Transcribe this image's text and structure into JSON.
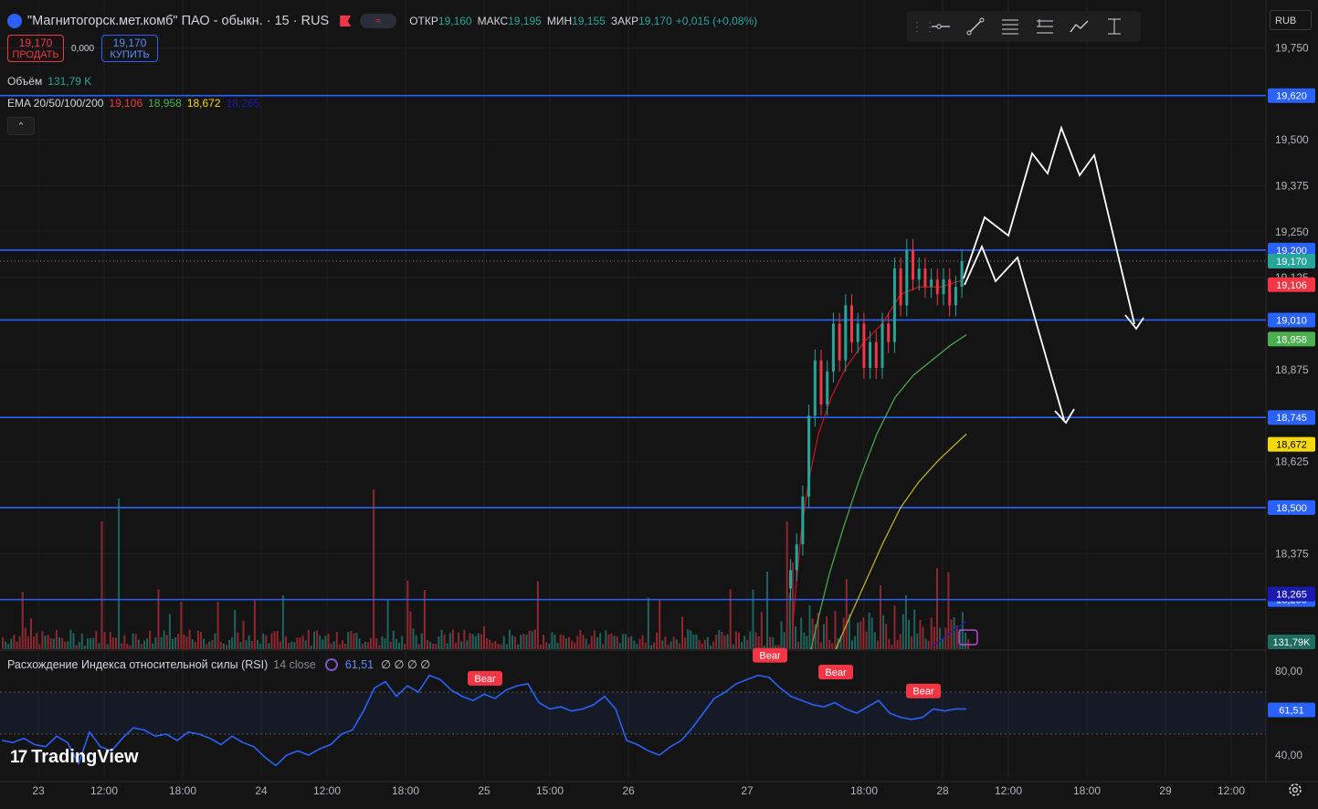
{
  "header": {
    "title": "\"Магнитогорск.мет.комб\" ПАО - обыкн. · 15 · RUS",
    "open_label": "ОТКР",
    "open_value": "19,160",
    "high_label": "МАКС",
    "high_value": "19,195",
    "low_label": "МИН",
    "low_value": "19,155",
    "close_label": "ЗАКР",
    "close_value": "19,170",
    "change": "+0,015 (+0,08%)"
  },
  "trade": {
    "sell_price": "19,170",
    "sell_label": "ПРОДАТЬ",
    "spread": "0,000",
    "buy_price": "19,170",
    "buy_label": "КУПИТЬ"
  },
  "volume_legend": {
    "label": "Объём",
    "value": "131,79 K"
  },
  "ema_legend": {
    "label": "EMA 20/50/100/200",
    "v20": "19,106",
    "v50": "18,958",
    "v100": "18,672",
    "v200": "18,265"
  },
  "currency": "RUB",
  "rsi_legend": {
    "label": "Расхождение Индекса относительной силы (RSI)",
    "params": "14 close",
    "value": "61,51",
    "extra": "∅ ∅ ∅ ∅"
  },
  "brand": "TradingView",
  "colors": {
    "bg": "#141414",
    "up": "#26a69a",
    "down": "#f23645",
    "level": "#2962ff",
    "ema20": "#c8161d",
    "ema50": "#4caf50",
    "ema100": "#c7b831",
    "ema200": "#1a1ab0",
    "rsi": "#2962ff",
    "bear": "#f23645",
    "arrow": "#ffffff"
  },
  "toolbar_icons": [
    "horizontal-ray-icon",
    "trend-line-icon",
    "fib-icon",
    "long-position-icon",
    "path-icon",
    "measure-icon"
  ],
  "chart_data": {
    "type": "candlestick",
    "price_axis": {
      "ylim": [
        18.115,
        19.88
      ],
      "ticks": [
        "19,750",
        "19,500",
        "19,375",
        "19,250",
        "19,125",
        "18,875",
        "18,625",
        "18,375"
      ],
      "tick_values": [
        19.75,
        19.5,
        19.375,
        19.25,
        19.125,
        18.875,
        18.625,
        18.375
      ]
    },
    "time_axis": {
      "labels": [
        "23",
        "12:00",
        "18:00",
        "24",
        "12:00",
        "18:00",
        "25",
        "15:00",
        "26",
        "27",
        "18:00",
        "28",
        "12:00",
        "18:00",
        "29",
        "12:00"
      ]
    },
    "levels": [
      19.62,
      19.2,
      19.01,
      18.745,
      18.5,
      18.25
    ],
    "level_labels": [
      "19,620",
      "19,200",
      "19,010",
      "18,745",
      "18,500",
      "18,250"
    ],
    "last_price": "19,170",
    "ema_values": {
      "ema20": "19,106",
      "ema50": "18,958",
      "ema100": "18,672",
      "ema200": "18,265"
    },
    "volume_last": "131,79K",
    "candles_last_day": [
      [
        18.28,
        18.33
      ],
      [
        18.33,
        18.4
      ],
      [
        18.4,
        18.53
      ],
      [
        18.53,
        18.75
      ],
      [
        18.75,
        18.9
      ],
      [
        18.9,
        18.78
      ],
      [
        18.78,
        18.87
      ],
      [
        18.87,
        19.0
      ],
      [
        19.0,
        18.9
      ],
      [
        18.9,
        19.05
      ],
      [
        19.05,
        18.95
      ],
      [
        18.95,
        19.0
      ],
      [
        19.0,
        18.88
      ],
      [
        18.88,
        18.95
      ],
      [
        18.95,
        18.88
      ],
      [
        18.88,
        19.0
      ],
      [
        19.0,
        18.95
      ],
      [
        18.95,
        19.15
      ],
      [
        19.15,
        19.05
      ],
      [
        19.05,
        19.2
      ],
      [
        19.2,
        19.12
      ],
      [
        19.12,
        19.15
      ],
      [
        19.15,
        19.1
      ],
      [
        19.1,
        19.12
      ],
      [
        19.12,
        19.08
      ],
      [
        19.08,
        19.12
      ],
      [
        19.12,
        19.05
      ],
      [
        19.05,
        19.1
      ],
      [
        19.1,
        19.17
      ]
    ],
    "rsi": {
      "ylim": [
        30,
        90
      ],
      "ticks": [
        "80,00",
        "40,00"
      ],
      "tick_values": [
        80,
        40
      ],
      "value": "61,51",
      "bands": [
        70,
        50
      ],
      "series": [
        47,
        46,
        48,
        45,
        44,
        49,
        46,
        36,
        51,
        44,
        42,
        48,
        53,
        52,
        49,
        50,
        47,
        51,
        50,
        48,
        45,
        49,
        46,
        44,
        39,
        35,
        40,
        42,
        40,
        43,
        45,
        50,
        52,
        61,
        72,
        75,
        68,
        73,
        70,
        78,
        76,
        71,
        68,
        66,
        69,
        67,
        71,
        73,
        74,
        65,
        62,
        63,
        61,
        62,
        64,
        68,
        62,
        47,
        45,
        42,
        40,
        44,
        47,
        53,
        60,
        67,
        70,
        74,
        76,
        78,
        77,
        72,
        68,
        66,
        64,
        63,
        65,
        62,
        60,
        63,
        66,
        60,
        58,
        57,
        58,
        62,
        61,
        62,
        62
      ],
      "divergences": [
        {
          "label": "Bear",
          "x_index": 44,
          "value": 67
        },
        {
          "label": "Bear",
          "x_index": 70,
          "value": 78
        },
        {
          "label": "Bear",
          "x_index": 76,
          "value": 70
        },
        {
          "label": "Bear",
          "x_index": 84,
          "value": 61
        }
      ]
    }
  }
}
